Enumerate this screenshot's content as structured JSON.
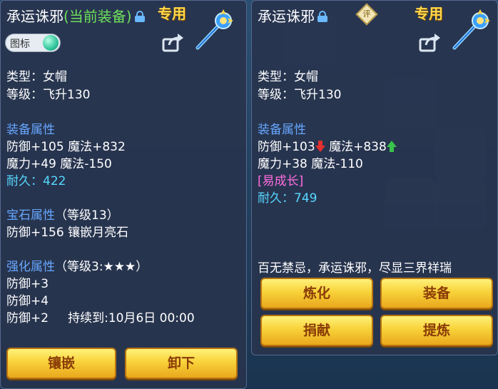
{
  "left": {
    "name": "承运诛邪",
    "current_tag": "(当前装备)",
    "special": "专用",
    "icon_toggle_label": "图标",
    "type_line": "类型：女帽",
    "level_line": "等级：飞升130",
    "equip_attr_title": "装备属性",
    "attr1": "防御+105 魔法+832",
    "attr2": "魔力+49 魔法-150",
    "durability": "耐久：422",
    "gem_title": "宝石属性",
    "gem_level": "（等级13）",
    "gem_attr": "防御+156 镶嵌月亮石",
    "enhance_title": "强化属性",
    "enhance_level": "（等级3:★★★）",
    "enh1": "防御+3",
    "enh2": "防御+4",
    "enh3": "防御+2",
    "enh3_duration": "持续到:10月6日 00:00",
    "buttons": {
      "inlay": "镶嵌",
      "unequip": "卸下"
    }
  },
  "right": {
    "name": "承运诛邪",
    "rate_badge": "评",
    "special": "专用",
    "type_line": "类型：女帽",
    "level_line": "等级：飞升130",
    "equip_attr_title": "装备属性",
    "attr1_a": "防御+103",
    "attr1_b": " 魔法+838",
    "attr2": "魔力+38 魔法-110",
    "growth": "[易成长]",
    "durability": "耐久：749",
    "description": "百无禁忌，承运诛邪，尽显三界祥瑞",
    "buttons": {
      "refine": "炼化",
      "equip": "装备",
      "donate": "捐献",
      "purify": "提炼"
    }
  },
  "colors": {
    "panel_bg": "#28344e",
    "section_blue": "#67a7ff",
    "durability_cyan": "#56d8ff",
    "current_green": "#6ee05a",
    "special_gold": "#ffd84a",
    "growth_pink": "#ff6ee0",
    "button_gold": "#f8d23a"
  },
  "icons": [
    "lock-icon",
    "weapon-staff-icon",
    "share-icon",
    "arrow-down-icon",
    "arrow-up-icon",
    "rate-badge-icon"
  ]
}
